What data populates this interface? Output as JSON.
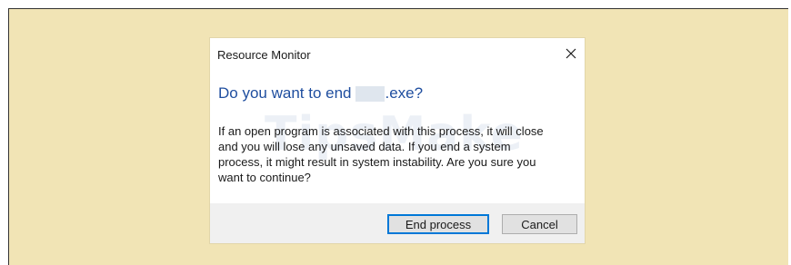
{
  "dialog": {
    "title": "Resource Monitor",
    "close_icon": "close-icon",
    "heading_prefix": "Do you want to end",
    "heading_suffix": ".exe?",
    "body_line_1": "If an open program is associated with this process, it will close",
    "body_line_2": "and you will lose any unsaved data. If you end a system",
    "body_line_3": "process, it might result in system instability. Are you sure you",
    "body_line_4": "want to continue?",
    "watermark": "TipsMake",
    "buttons": {
      "primary_label": "End process",
      "cancel_label": "Cancel"
    }
  },
  "colors": {
    "backdrop": "#f1e4b5",
    "heading": "#1f4e9f",
    "focus_border": "#0078d7"
  }
}
